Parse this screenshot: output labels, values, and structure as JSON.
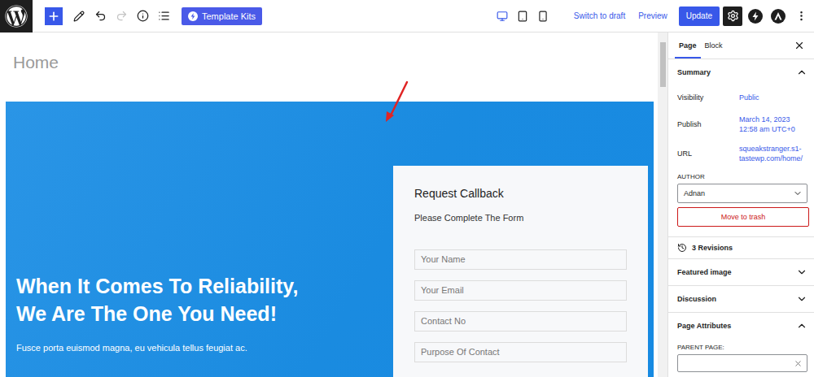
{
  "toolbar": {
    "history": {
      "undo_disabled": false,
      "redo_disabled": true
    },
    "template_kits": "Template Kits",
    "devices": [
      {
        "selected": true
      },
      {
        "selected": false
      },
      {
        "selected": false
      }
    ],
    "switch_to_draft": "Switch to draft",
    "preview": "Preview",
    "update": "Update",
    "settings_selected": true
  },
  "editor": {
    "title": "Home",
    "hero": {
      "heading_lines": [
        "When It Comes To Reliability,",
        "We Are The One You Need!"
      ],
      "text": "Fusce porta euismod magna, eu vehicula tellus feugiat ac."
    },
    "form": {
      "title": "Request Callback",
      "subtitle": "Please Complete The Form",
      "fields": [
        {
          "placeholder": "Your Name"
        },
        {
          "placeholder": "Your Email"
        },
        {
          "placeholder": "Contact No"
        },
        {
          "placeholder": "Purpose Of Contact"
        }
      ]
    }
  },
  "sidebar": {
    "tabs": [
      {
        "label": "Page",
        "selected": true
      },
      {
        "label": "Block",
        "selected": false
      }
    ],
    "summary": {
      "title": "Summary",
      "expanded": true,
      "rows": [
        {
          "label": "Visibility",
          "value_lines": [
            "Public"
          ]
        },
        {
          "label": "Publish",
          "value_lines": [
            "March 14, 2023",
            "12:58 am UTC+0"
          ]
        },
        {
          "label": "URL",
          "value_lines": [
            "squeakstranger.s1-",
            "tastewp.com/home/"
          ]
        }
      ],
      "author_label": "AUTHOR",
      "author": "Adnan",
      "trash": "Move to trash"
    },
    "revisions": "3 Revisions",
    "panels": [
      {
        "title": "Featured image",
        "expanded": false
      },
      {
        "title": "Discussion",
        "expanded": false
      },
      {
        "title": "Page Attributes",
        "expanded": true,
        "field_label": "PARENT PAGE:"
      }
    ]
  }
}
